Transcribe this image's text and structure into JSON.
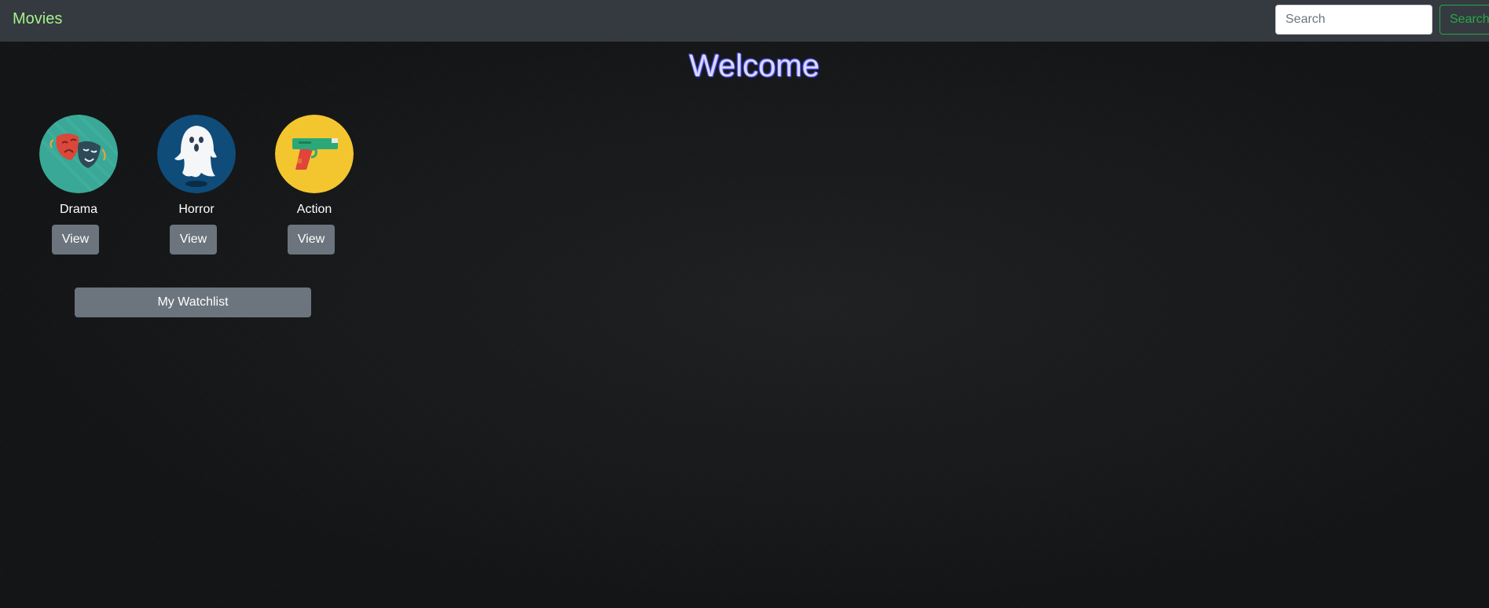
{
  "navbar": {
    "brand": "Movies",
    "search": {
      "placeholder": "Search",
      "value": "",
      "button_label": "Search"
    }
  },
  "main": {
    "heading": "Welcome",
    "genres": [
      {
        "label": "Drama",
        "icon": "theater-masks-icon",
        "view_label": "View",
        "color": "#3aa896"
      },
      {
        "label": "Horror",
        "icon": "ghost-icon",
        "view_label": "View",
        "color": "#0f4c7a"
      },
      {
        "label": "Action",
        "icon": "pistol-icon",
        "view_label": "View",
        "color": "#f3c62f"
      }
    ],
    "watchlist_label": "My Watchlist"
  },
  "colors": {
    "navbar_bg": "#343a40",
    "brand": "#a6f08a",
    "search_button": "#28a745",
    "secondary_button": "#6c757d",
    "heading": "#d8d8ff"
  }
}
